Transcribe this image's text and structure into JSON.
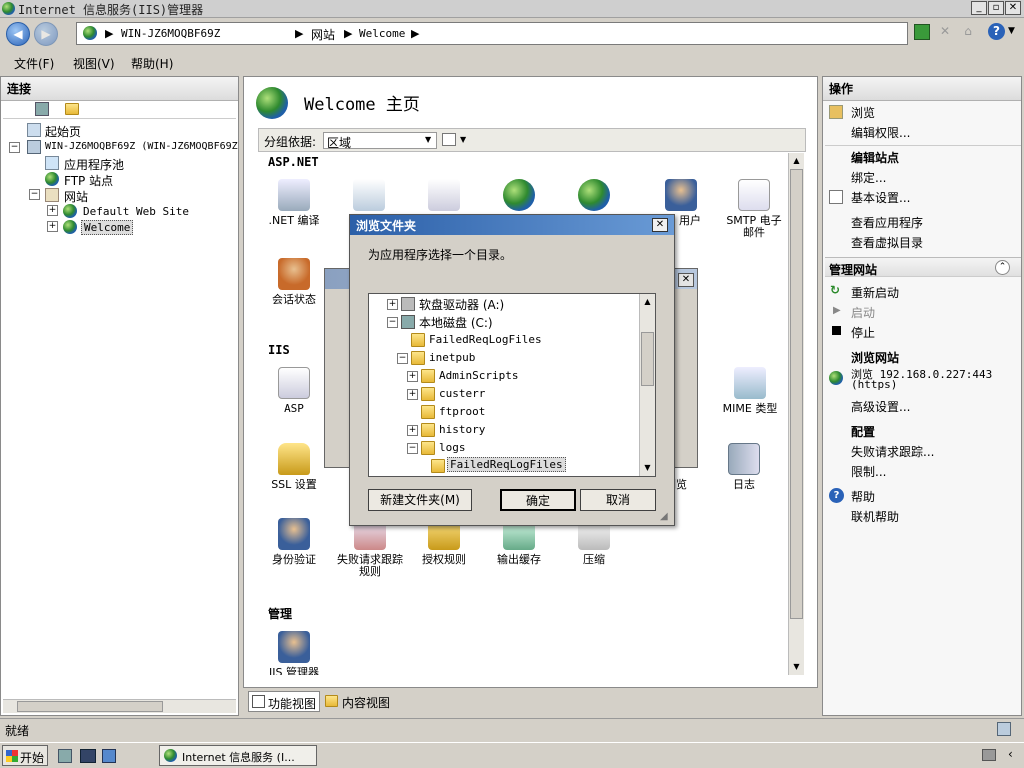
{
  "window": {
    "title": "Internet 信息服务(IIS)管理器"
  },
  "address": {
    "host": "WIN-JZ6MOQBF69Z",
    "sites": "网站",
    "site": "Welcome"
  },
  "menu": {
    "file": "文件(F)",
    "view": "视图(V)",
    "help": "帮助(H)"
  },
  "connections": {
    "title": "连接",
    "start_page": "起始页",
    "server": "WIN-JZ6MOQBF69Z (WIN-JZ6MOQBF69Z",
    "app_pools": "应用程序池",
    "ftp_sites": "FTP 站点",
    "sites": "网站",
    "default_site": "Default Web Site",
    "welcome": "Welcome"
  },
  "main": {
    "title": "Welcome 主页",
    "group_by_label": "分组依据:",
    "group_by_value": "区域",
    "groups": {
      "aspnet": "ASP.NET",
      "iis": "IIS",
      "manage": "管理"
    },
    "features": {
      "net_compile": ".NET 编译",
      "users": "用户",
      "smtp": "SMTP 电子邮件",
      "session": "会话状态",
      "asp": "ASP",
      "mime": "MIME 类型",
      "ssl": "SSL 设置",
      "browse": "浏览",
      "logging": "日志",
      "auth": "身份验证",
      "failed_req": "失败请求跟踪规则",
      "authz": "授权规则",
      "output_cache": "输出缓存",
      "compress": "压缩",
      "iis_mgr": "IIS 管理器"
    },
    "view_features": "功能视图",
    "view_content": "内容视图"
  },
  "actions": {
    "title": "操作",
    "browse": "浏览",
    "edit_perms": "编辑权限...",
    "edit_site": "编辑站点",
    "bindings": "绑定...",
    "basic_settings": "基本设置...",
    "view_apps": "查看应用程序",
    "view_vdirs": "查看虚拟目录",
    "manage_site": "管理网站",
    "restart": "重新启动",
    "start": "启动",
    "stop": "停止",
    "browse_site": "浏览网站",
    "browse_url": "浏览 192.168.0.227:443",
    "browse_proto": "(https)",
    "advanced": "高级设置...",
    "config": "配置",
    "failed_tracing": "失败请求跟踪...",
    "limits": "限制...",
    "help": "帮助",
    "online_help": "联机帮助"
  },
  "dialog": {
    "title": "浏览文件夹",
    "prompt": "为应用程序选择一个目录。",
    "items": [
      "软盘驱动器 (A:)",
      "本地磁盘 (C:)",
      "FailedReqLogFiles",
      "inetpub",
      "AdminScripts",
      "custerr",
      "ftproot",
      "history",
      "logs",
      "FailedReqLogFiles"
    ],
    "new_folder": "新建文件夹(M)",
    "ok": "确定",
    "cancel": "取消"
  },
  "status": {
    "text": "就绪"
  },
  "taskbar": {
    "start": "开始",
    "task": "Internet 信息服务 (I..."
  }
}
